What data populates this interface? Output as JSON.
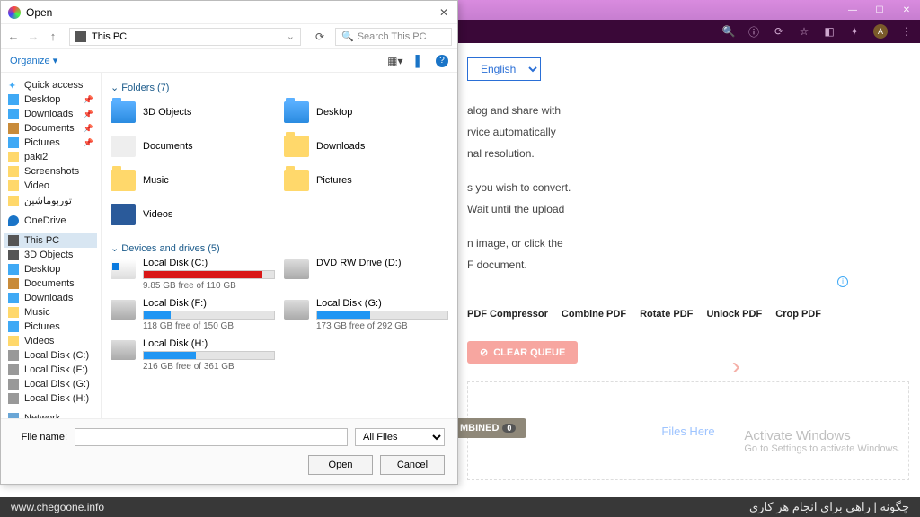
{
  "browser": {
    "window_controls": [
      "—",
      "☐",
      "✕"
    ],
    "toolbar_icons": [
      "🔍",
      "ⓘ",
      "⟳",
      "☆",
      "◧",
      "✦"
    ],
    "avatar": "A",
    "menu": "⋮"
  },
  "page": {
    "lang_selector": "English",
    "para1_a": "alog and share with",
    "para1_b": "rvice automatically",
    "para1_c": "nal resolution.",
    "para2_a": "s you wish to convert.",
    "para2_b": "Wait until the upload",
    "para3_a": "n image, or click the",
    "para3_b": "F document.",
    "tools": [
      "PDF Compressor",
      "Combine PDF",
      "Rotate PDF",
      "Unlock PDF",
      "Crop PDF"
    ],
    "clear_queue": "CLEAR QUEUE",
    "drop_text": "Files Here",
    "combined": "MBINED",
    "combined_count": "0",
    "activate_t": "Activate Windows",
    "activate_s": "Go to Settings to activate Windows."
  },
  "dialog": {
    "title": "Open",
    "close": "✕",
    "path": "This PC",
    "search_placeholder": "Search This PC",
    "organize": "Organize ▾",
    "help": "?",
    "filename_label": "File name:",
    "filter": "All Files",
    "open_btn": "Open",
    "cancel_btn": "Cancel"
  },
  "sidebar": {
    "quick": "Quick access",
    "items1": [
      {
        "label": "Desktop",
        "cls": "i-desk",
        "pin": true
      },
      {
        "label": "Downloads",
        "cls": "i-dl",
        "pin": true
      },
      {
        "label": "Documents",
        "cls": "i-doc",
        "pin": true
      },
      {
        "label": "Pictures",
        "cls": "i-pic",
        "pin": true
      },
      {
        "label": "paki2",
        "cls": "i-fold",
        "pin": false
      },
      {
        "label": "Screenshots",
        "cls": "i-fold",
        "pin": false
      },
      {
        "label": "Video",
        "cls": "i-fold",
        "pin": false
      },
      {
        "label": "توربوماشین",
        "cls": "i-fold",
        "pin": false
      }
    ],
    "onedrive": "OneDrive",
    "thispc": "This PC",
    "items2": [
      {
        "label": "3D Objects",
        "cls": "i-pc"
      },
      {
        "label": "Desktop",
        "cls": "i-desk"
      },
      {
        "label": "Documents",
        "cls": "i-doc"
      },
      {
        "label": "Downloads",
        "cls": "i-dl"
      },
      {
        "label": "Music",
        "cls": "i-fold"
      },
      {
        "label": "Pictures",
        "cls": "i-pic"
      },
      {
        "label": "Videos",
        "cls": "i-fold"
      },
      {
        "label": "Local Disk (C:)",
        "cls": "i-drv"
      },
      {
        "label": "Local Disk (F:)",
        "cls": "i-drv"
      },
      {
        "label": "Local Disk (G:)",
        "cls": "i-drv"
      },
      {
        "label": "Local Disk (H:)",
        "cls": "i-drv"
      }
    ],
    "network": "Network"
  },
  "main": {
    "folders_h": "Folders (7)",
    "folders": [
      {
        "label": "3D Objects",
        "ico": "blue"
      },
      {
        "label": "Desktop",
        "ico": "blue"
      },
      {
        "label": "Documents",
        "ico": "doc"
      },
      {
        "label": "Downloads",
        "ico": ""
      },
      {
        "label": "Music",
        "ico": ""
      },
      {
        "label": "Pictures",
        "ico": ""
      },
      {
        "label": "Videos",
        "ico": "vid"
      }
    ],
    "drives_h": "Devices and drives (5)",
    "drives": [
      {
        "name": "Local Disk (C:)",
        "free": "9.85 GB free of 110 GB",
        "fill": 91,
        "color": "red",
        "ico": "win"
      },
      {
        "name": "DVD RW Drive (D:)",
        "free": "",
        "fill": 0,
        "color": "",
        "ico": ""
      },
      {
        "name": "Local Disk (F:)",
        "free": "118 GB free of 150 GB",
        "fill": 21,
        "color": "blue",
        "ico": ""
      },
      {
        "name": "Local Disk (G:)",
        "free": "173 GB free of 292 GB",
        "fill": 41,
        "color": "blue",
        "ico": ""
      },
      {
        "name": "Local Disk (H:)",
        "free": "216 GB free of 361 GB",
        "fill": 40,
        "color": "blue",
        "ico": ""
      }
    ]
  },
  "footer": {
    "url": "www.chegoone.info",
    "fa": "چگونه | راهی برای انجام هر کاری"
  }
}
